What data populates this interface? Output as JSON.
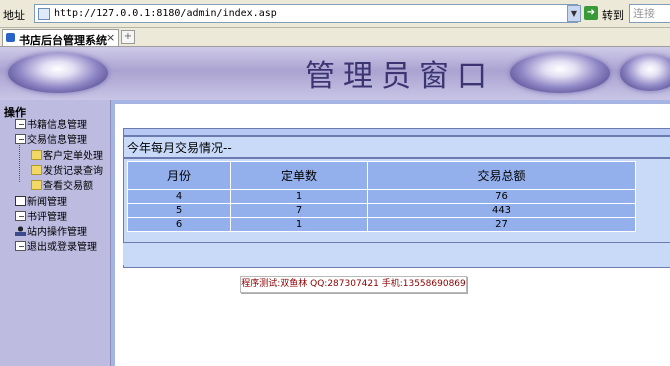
{
  "browser": {
    "address_label": "地址",
    "url": "http://127.0.0.1:8180/admin/index.asp",
    "go_label": "转到",
    "search_placeholder": "连接"
  },
  "tab": {
    "title": "书店后台管理系统",
    "close": "×",
    "new": "+"
  },
  "banner": {
    "title": "管理员窗口"
  },
  "menu": {
    "title": "操作",
    "items": [
      {
        "label": "书籍信息管理",
        "icon": "book-icon"
      },
      {
        "label": "交易信息管理",
        "icon": "book-icon"
      },
      {
        "label": "客户定单处理",
        "icon": "folder-icon"
      },
      {
        "label": "发货记录查询",
        "icon": "folder-icon"
      },
      {
        "label": "查看交易额",
        "icon": "folder-icon"
      },
      {
        "label": "新闻管理",
        "icon": "news-icon"
      },
      {
        "label": "书评管理",
        "icon": "book-icon"
      },
      {
        "label": "站内操作管理",
        "icon": "person-icon"
      },
      {
        "label": "退出或登录管理",
        "icon": "book-icon"
      }
    ]
  },
  "panel": {
    "heading": "今年每月交易情况--",
    "columns": [
      "月份",
      "定单数",
      "交易总额"
    ],
    "rows": [
      [
        "4",
        "1",
        "76"
      ],
      [
        "5",
        "7",
        "443"
      ],
      [
        "6",
        "1",
        "27"
      ]
    ]
  },
  "footer": {
    "credit": "程序测试:双鱼林 QQ:287307421 手机:13558690869"
  },
  "colors": {
    "sidebar_bg": "#bdbbe0",
    "table_bg": "#94b0ec",
    "panel_bg": "#c9daf8",
    "title_color": "#3d3472"
  }
}
